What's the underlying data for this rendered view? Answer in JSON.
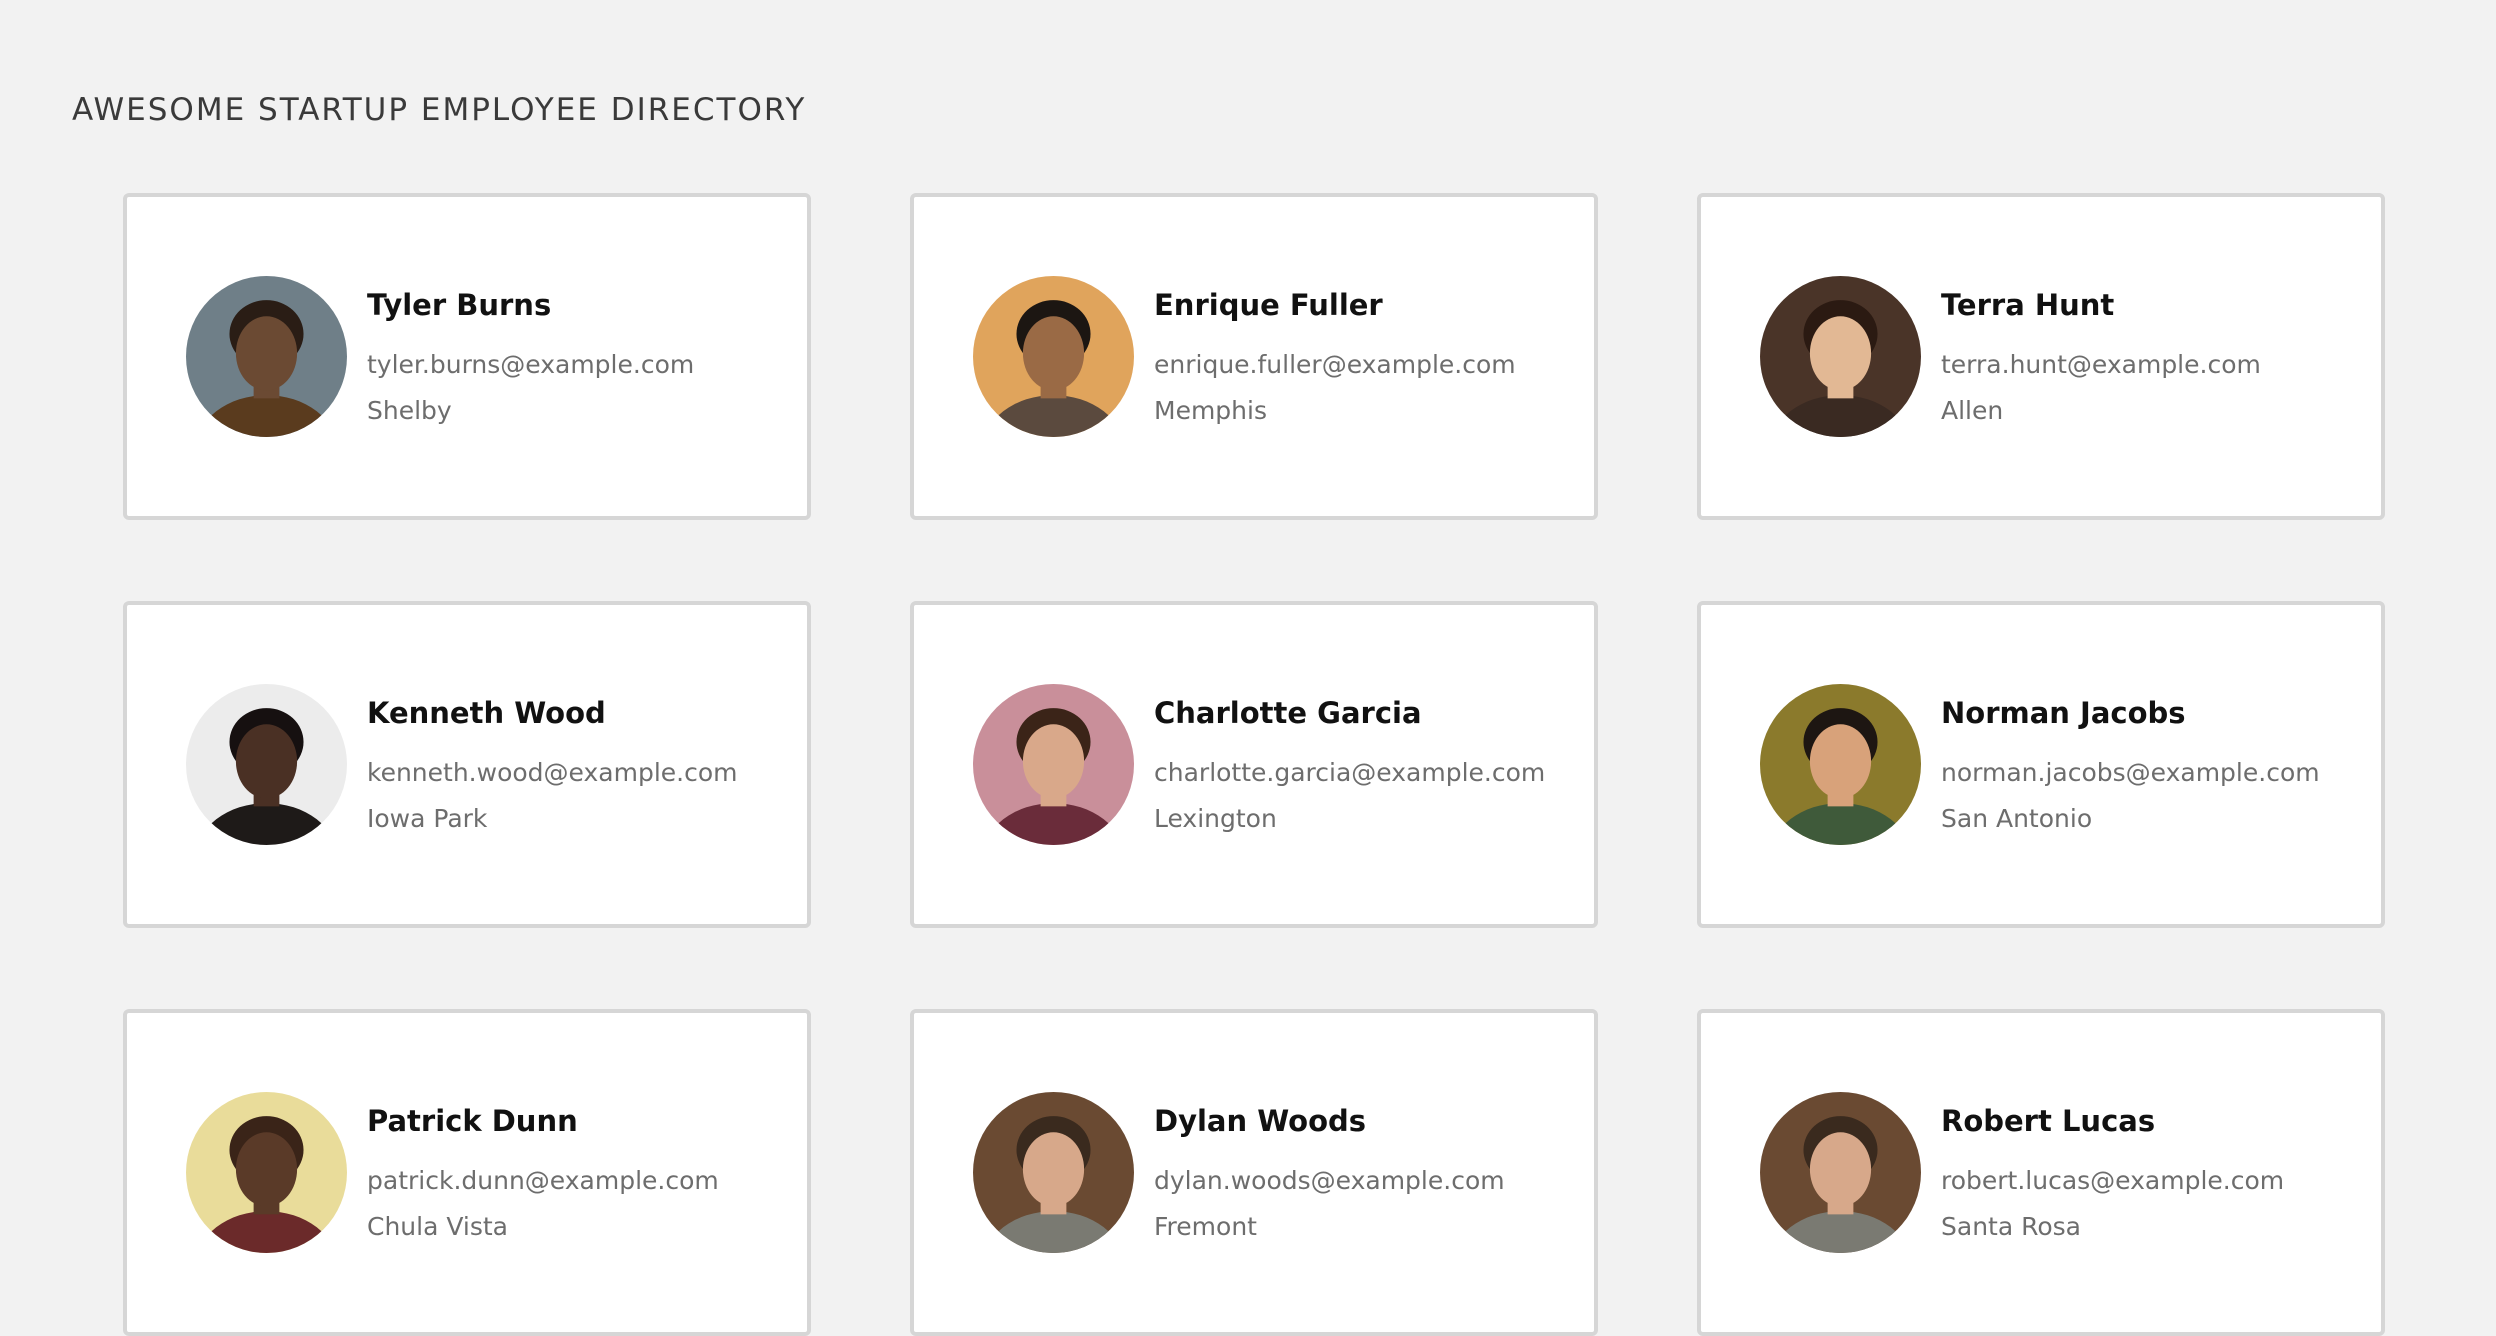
{
  "header": {
    "title": "AWESOME STARTUP EMPLOYEE DIRECTORY"
  },
  "employees": [
    {
      "name": "Tyler Burns",
      "email": "tyler.burns@example.com",
      "city": "Shelby",
      "avatar": {
        "bg": "#6f7f88",
        "skin": "#6b4a33",
        "hair": "#2a1d15",
        "shirt": "#5a3b1e"
      }
    },
    {
      "name": "Enrique Fuller",
      "email": "enrique.fuller@example.com",
      "city": "Memphis",
      "avatar": {
        "bg": "#e0a45c",
        "skin": "#9a6a45",
        "hair": "#1c1612",
        "shirt": "#5b4a3e"
      }
    },
    {
      "name": "Terra Hunt",
      "email": "terra.hunt@example.com",
      "city": "Allen",
      "avatar": {
        "bg": "#4a3428",
        "skin": "#e2b894",
        "hair": "#2b1a12",
        "shirt": "#3a2a22"
      }
    },
    {
      "name": "Kenneth Wood",
      "email": "kenneth.wood@example.com",
      "city": "Iowa Park",
      "avatar": {
        "bg": "#ececec",
        "skin": "#4a3024",
        "hair": "#161010",
        "shirt": "#1e1a18"
      }
    },
    {
      "name": "Charlotte Garcia",
      "email": "charlotte.garcia@example.com",
      "city": "Lexington",
      "avatar": {
        "bg": "#c98f9a",
        "skin": "#d9a88a",
        "hair": "#3b2418",
        "shirt": "#6a2c3a"
      }
    },
    {
      "name": "Norman Jacobs",
      "email": "norman.jacobs@example.com",
      "city": "San Antonio",
      "avatar": {
        "bg": "#8b7a2c",
        "skin": "#d8a27a",
        "hair": "#1d1612",
        "shirt": "#3f5a3a"
      }
    },
    {
      "name": "Patrick Dunn",
      "email": "patrick.dunn@example.com",
      "city": "Chula Vista",
      "avatar": {
        "bg": "#e9dc9a",
        "skin": "#5a3a28",
        "hair": "#3a2418",
        "shirt": "#6b2a2a"
      }
    },
    {
      "name": "Dylan Woods",
      "email": "dylan.woods@example.com",
      "city": "Fremont",
      "avatar": {
        "bg": "#6a4a32",
        "skin": "#d7a88a",
        "hair": "#3a2a1e",
        "shirt": "#7a7a72"
      }
    },
    {
      "name": "Robert Lucas",
      "email": "robert.lucas@example.com",
      "city": "Santa Rosa",
      "avatar": {
        "bg": "#6a4a32",
        "skin": "#d7a88a",
        "hair": "#3a2a1e",
        "shirt": "#7a7a72"
      }
    }
  ]
}
